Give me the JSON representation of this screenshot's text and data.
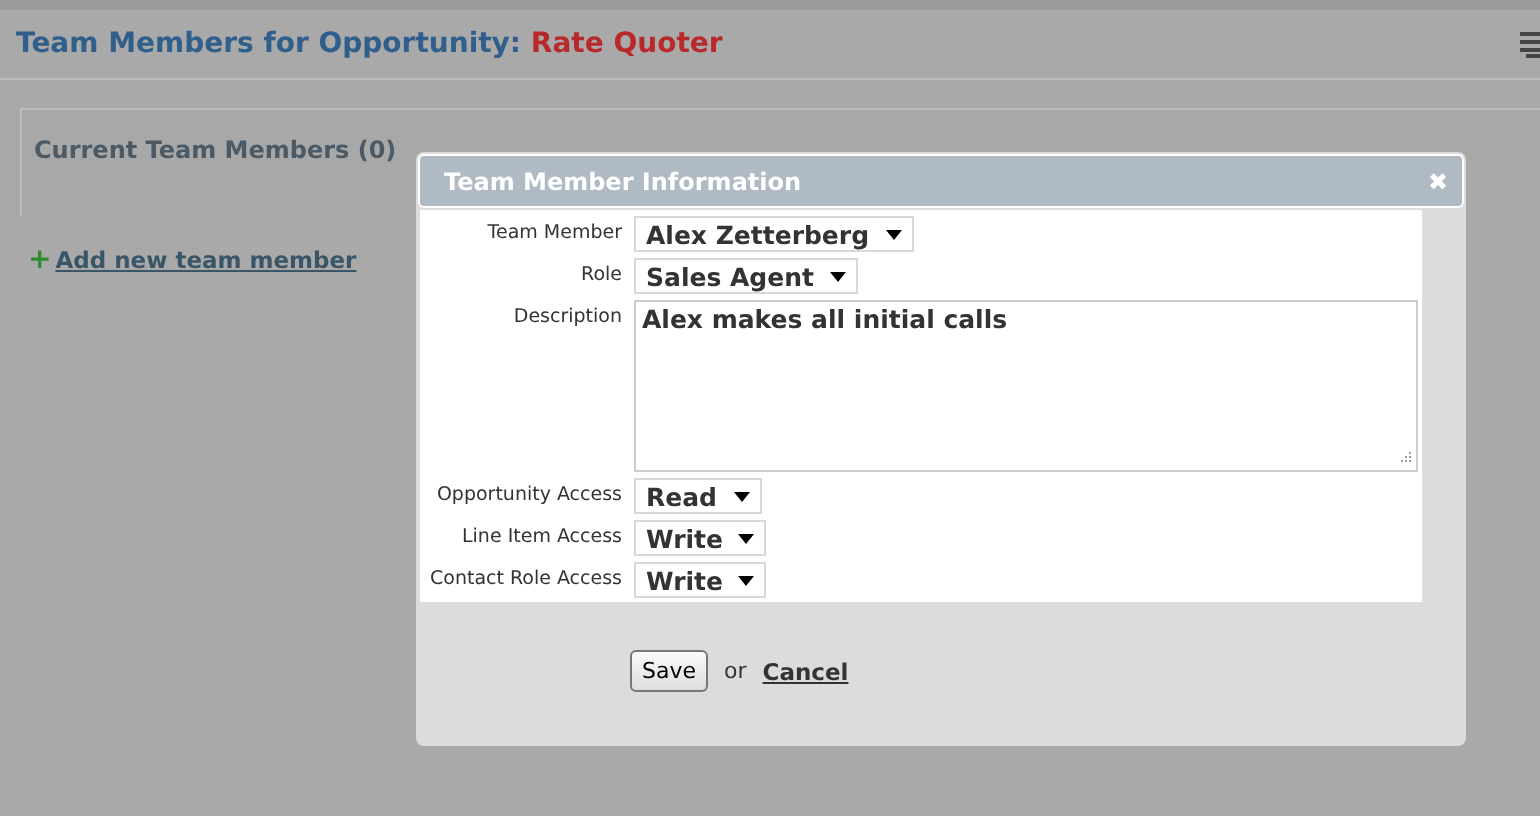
{
  "page": {
    "title": "Team Members for Opportunity:",
    "opportunity": "Rate Quoter"
  },
  "panel": {
    "heading": "Current Team Members (0)"
  },
  "add_link": {
    "icon": "+",
    "label": "Add new team member"
  },
  "dialog": {
    "title": "Team Member Information",
    "close": "✖",
    "fields": [
      {
        "kind": "select",
        "label": "Team Member",
        "value": "Alex Zetterberg"
      },
      {
        "kind": "select",
        "label": "Role",
        "value": "Sales Agent"
      },
      {
        "kind": "textarea",
        "label": "Description",
        "value": "Alex makes all initial calls"
      },
      {
        "kind": "select",
        "label": "Opportunity Access",
        "value": "Read"
      },
      {
        "kind": "select",
        "label": "Line Item Access",
        "value": "Write"
      },
      {
        "kind": "select",
        "label": "Contact Role Access",
        "value": "Write"
      }
    ],
    "save": "Save",
    "or": "or",
    "cancel": "Cancel"
  }
}
